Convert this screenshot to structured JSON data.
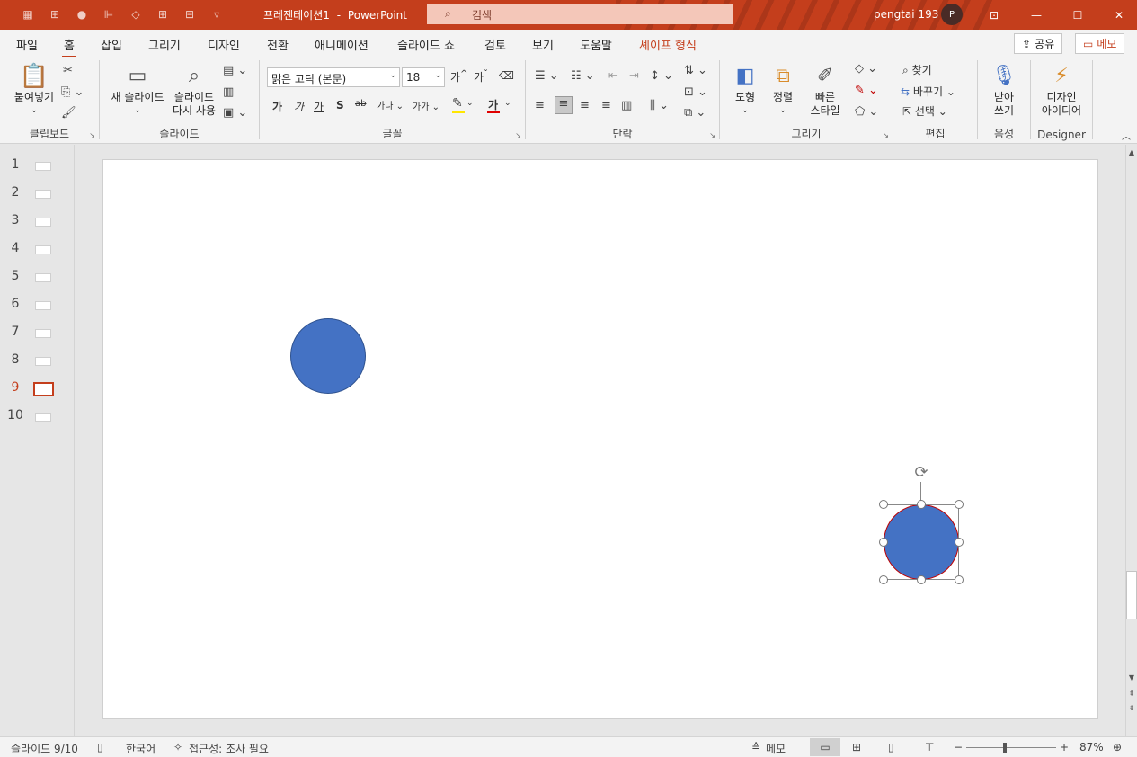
{
  "window": {
    "doc_title": "프레젠테이션1",
    "app_name": "PowerPoint",
    "title_separator": "-",
    "search_placeholder": "검색",
    "user_name": "pengtai 193",
    "user_initial": "P",
    "accent_color": "#c43e1c"
  },
  "tabs": [
    {
      "label": "파일"
    },
    {
      "label": "홈"
    },
    {
      "label": "삽입"
    },
    {
      "label": "그리기"
    },
    {
      "label": "디자인"
    },
    {
      "label": "전환"
    },
    {
      "label": "애니메이션"
    },
    {
      "label": "슬라이드 쇼"
    },
    {
      "label": "검토"
    },
    {
      "label": "보기"
    },
    {
      "label": "도움말"
    },
    {
      "label": "셰이프 형식"
    }
  ],
  "active_tab": "홈",
  "header_buttons": {
    "share": "공유",
    "memo": "메모"
  },
  "ribbon": {
    "clipboard": {
      "label": "클립보드",
      "paste": "붙여넣기"
    },
    "slides": {
      "label": "슬라이드",
      "new_slide": "새 슬라이드",
      "reuse_line1": "슬라이드",
      "reuse_line2": "다시 사용"
    },
    "font": {
      "label": "글꼴",
      "font_name": "맑은 고딕 (본문)",
      "font_size": "18",
      "bold": "가",
      "italic": "가",
      "underline": "가",
      "shadow": "S",
      "strike": "ab",
      "spacing": "가나",
      "case": "가가",
      "font_color_char": "가",
      "grow": "가",
      "shrink": "가"
    },
    "paragraph": {
      "label": "단락"
    },
    "drawing": {
      "label": "그리기",
      "shapes": "도형",
      "arrange": "정렬",
      "quick_styles_line1": "빠른",
      "quick_styles_line2": "스타일"
    },
    "editing": {
      "label": "편집",
      "find": "찾기",
      "replace": "바꾸기",
      "select": "선택"
    },
    "voice": {
      "label": "음성",
      "dictate_line1": "받아",
      "dictate_line2": "쓰기"
    },
    "designer": {
      "label": "Designer",
      "ideas_line1": "디자인",
      "ideas_line2": "아이디어"
    }
  },
  "slides_panel": {
    "slides": [
      {
        "number": "1"
      },
      {
        "number": "2"
      },
      {
        "number": "3"
      },
      {
        "number": "4"
      },
      {
        "number": "5"
      },
      {
        "number": "6"
      },
      {
        "number": "7"
      },
      {
        "number": "8"
      },
      {
        "number": "9"
      },
      {
        "number": "10"
      }
    ],
    "selected": "9"
  },
  "canvas": {
    "shape_fill": "#4472c4",
    "selected_shape_outline": "#c00000"
  },
  "status": {
    "slide_indicator": "슬라이드 9/10",
    "language": "한국어",
    "accessibility": "접근성: 조사 필요",
    "notes": "메모",
    "zoom_minus": "−",
    "zoom_plus": "+",
    "zoom_level": "87%"
  }
}
